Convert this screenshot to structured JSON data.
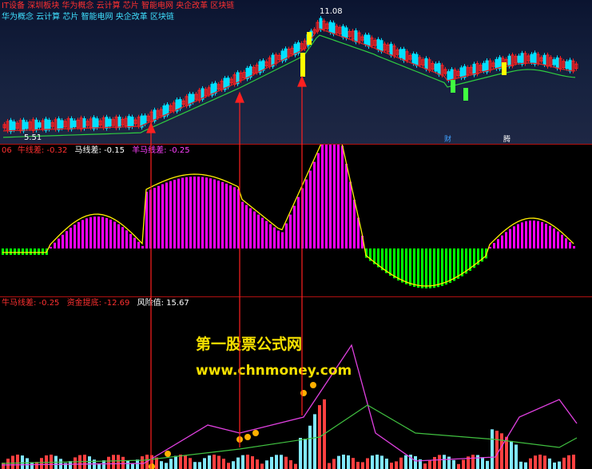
{
  "panel1": {
    "line1": "IT设备 深圳板块 华为概念 云计算 芯片 智能电网 央企改革 区块链",
    "line2": "华为概念 云计算 芯片 智能电网 央企改革 区块链",
    "high_label": "11.08",
    "low_label": "5.51",
    "marker_cai": "财",
    "marker_teng": "腾"
  },
  "panel2": {
    "prefix": "06",
    "short_diff": "牛线差: -0.32",
    "mid_diff": "马线差: -0.15",
    "long_diff": "羊马线差: -0.25"
  },
  "panel3": {
    "diff": "牛马线差: -0.25",
    "fund_lift": "资金提底: -12.69",
    "risk": "风险值: 15.67"
  },
  "watermark": {
    "title": "第一股票公式网",
    "url": "www.chnmoney.com"
  },
  "colors": {
    "up": "#ff2020",
    "down": "#00e0ff",
    "ma_fast": "#e02020",
    "ma_slow": "#2ecc40",
    "hist_pos": "#ff00ff",
    "hist_neg": "#00ff00",
    "signal": "#ffee00"
  }
}
